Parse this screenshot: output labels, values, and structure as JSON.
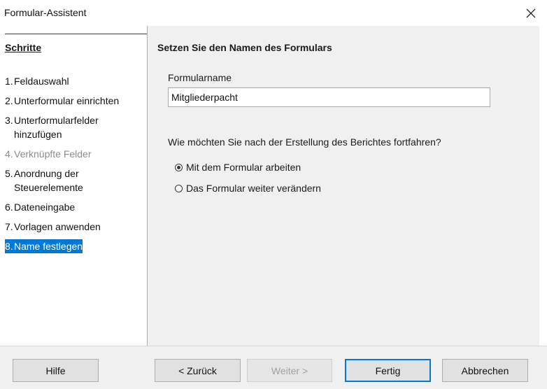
{
  "window": {
    "title": "Formular-Assistent",
    "close_icon": "close-icon"
  },
  "steps": {
    "heading": "Schritte",
    "items": [
      {
        "num": "1.",
        "label": "Feldauswahl",
        "state": "normal"
      },
      {
        "num": "2.",
        "label": "Unterformular einrichten",
        "state": "normal"
      },
      {
        "num": "3.",
        "label": "Unterformularfelder hinzufügen",
        "state": "normal"
      },
      {
        "num": "4.",
        "label": "Verknüpfte Felder",
        "state": "disabled"
      },
      {
        "num": "5.",
        "label": "Anordnung der Steuerelemente",
        "state": "normal"
      },
      {
        "num": "6.",
        "label": "Dateneingabe",
        "state": "normal"
      },
      {
        "num": "7.",
        "label": "Vorlagen anwenden",
        "state": "normal"
      },
      {
        "num": "8.",
        "label": "Name festlegen",
        "state": "selected"
      }
    ]
  },
  "main": {
    "section_title": "Setzen Sie den Namen des Formulars",
    "name_label": "Formularname",
    "name_value": "Mitgliederpacht",
    "question": "Wie möchten Sie nach der Erstellung des Berichtes fortfahren?",
    "options": [
      {
        "label": "Mit dem Formular arbeiten",
        "checked": true
      },
      {
        "label": "Das Formular weiter verändern",
        "checked": false
      }
    ]
  },
  "buttons": {
    "help": "Hilfe",
    "back": "< Zurück",
    "next": "Weiter >",
    "finish": "Fertig",
    "cancel": "Abbrechen"
  },
  "colors": {
    "selection": "#0078d7",
    "disabled_text": "#8c8c8c"
  }
}
